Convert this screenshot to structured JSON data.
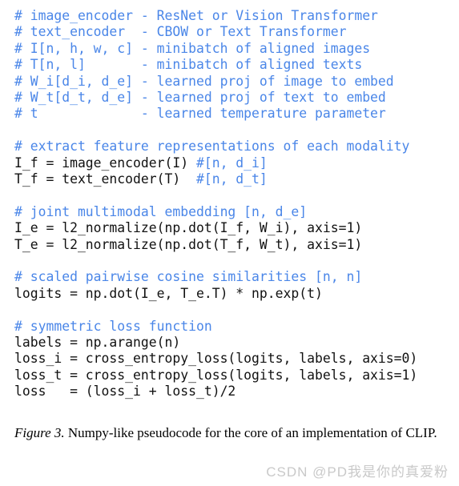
{
  "figure": {
    "code_lines": [
      {
        "type": "comment",
        "text": "# image_encoder - ResNet or Vision Transformer"
      },
      {
        "type": "comment",
        "text": "# text_encoder  - CBOW or Text Transformer"
      },
      {
        "type": "comment",
        "text": "# I[n, h, w, c] - minibatch of aligned images"
      },
      {
        "type": "comment",
        "text": "# T[n, l]       - minibatch of aligned texts"
      },
      {
        "type": "comment",
        "text": "# W_i[d_i, d_e] - learned proj of image to embed"
      },
      {
        "type": "comment",
        "text": "# W_t[d_t, d_e] - learned proj of text to embed"
      },
      {
        "type": "comment",
        "text": "# t             - learned temperature parameter"
      },
      {
        "type": "blank",
        "text": ""
      },
      {
        "type": "comment",
        "text": "# extract feature representations of each modality"
      },
      {
        "type": "mixed",
        "code": "I_f = image_encoder(I) ",
        "comment": "#[n, d_i]"
      },
      {
        "type": "mixed",
        "code": "T_f = text_encoder(T)  ",
        "comment": "#[n, d_t]"
      },
      {
        "type": "blank",
        "text": ""
      },
      {
        "type": "comment",
        "text": "# joint multimodal embedding [n, d_e]"
      },
      {
        "type": "code",
        "text": "I_e = l2_normalize(np.dot(I_f, W_i), axis=1)"
      },
      {
        "type": "code",
        "text": "T_e = l2_normalize(np.dot(T_f, W_t), axis=1)"
      },
      {
        "type": "blank",
        "text": ""
      },
      {
        "type": "comment",
        "text": "# scaled pairwise cosine similarities [n, n]"
      },
      {
        "type": "code",
        "text": "logits = np.dot(I_e, T_e.T) * np.exp(t)"
      },
      {
        "type": "blank",
        "text": ""
      },
      {
        "type": "comment",
        "text": "# symmetric loss function"
      },
      {
        "type": "code",
        "text": "labels = np.arange(n)"
      },
      {
        "type": "code",
        "text": "loss_i = cross_entropy_loss(logits, labels, axis=0)"
      },
      {
        "type": "code",
        "text": "loss_t = cross_entropy_loss(logits, labels, axis=1)"
      },
      {
        "type": "code",
        "text": "loss   = (loss_i + loss_t)/2"
      }
    ],
    "caption": {
      "label": "Figure 3.",
      "text": " Numpy-like pseudocode for the core of an implementation of CLIP."
    },
    "watermark": "CSDN @PD我是你的真爱粉",
    "colors": {
      "comment": "#4a86e8",
      "code": "#111111",
      "caption": "#000000",
      "watermark": "#c9c9c9",
      "background": "#ffffff"
    }
  }
}
